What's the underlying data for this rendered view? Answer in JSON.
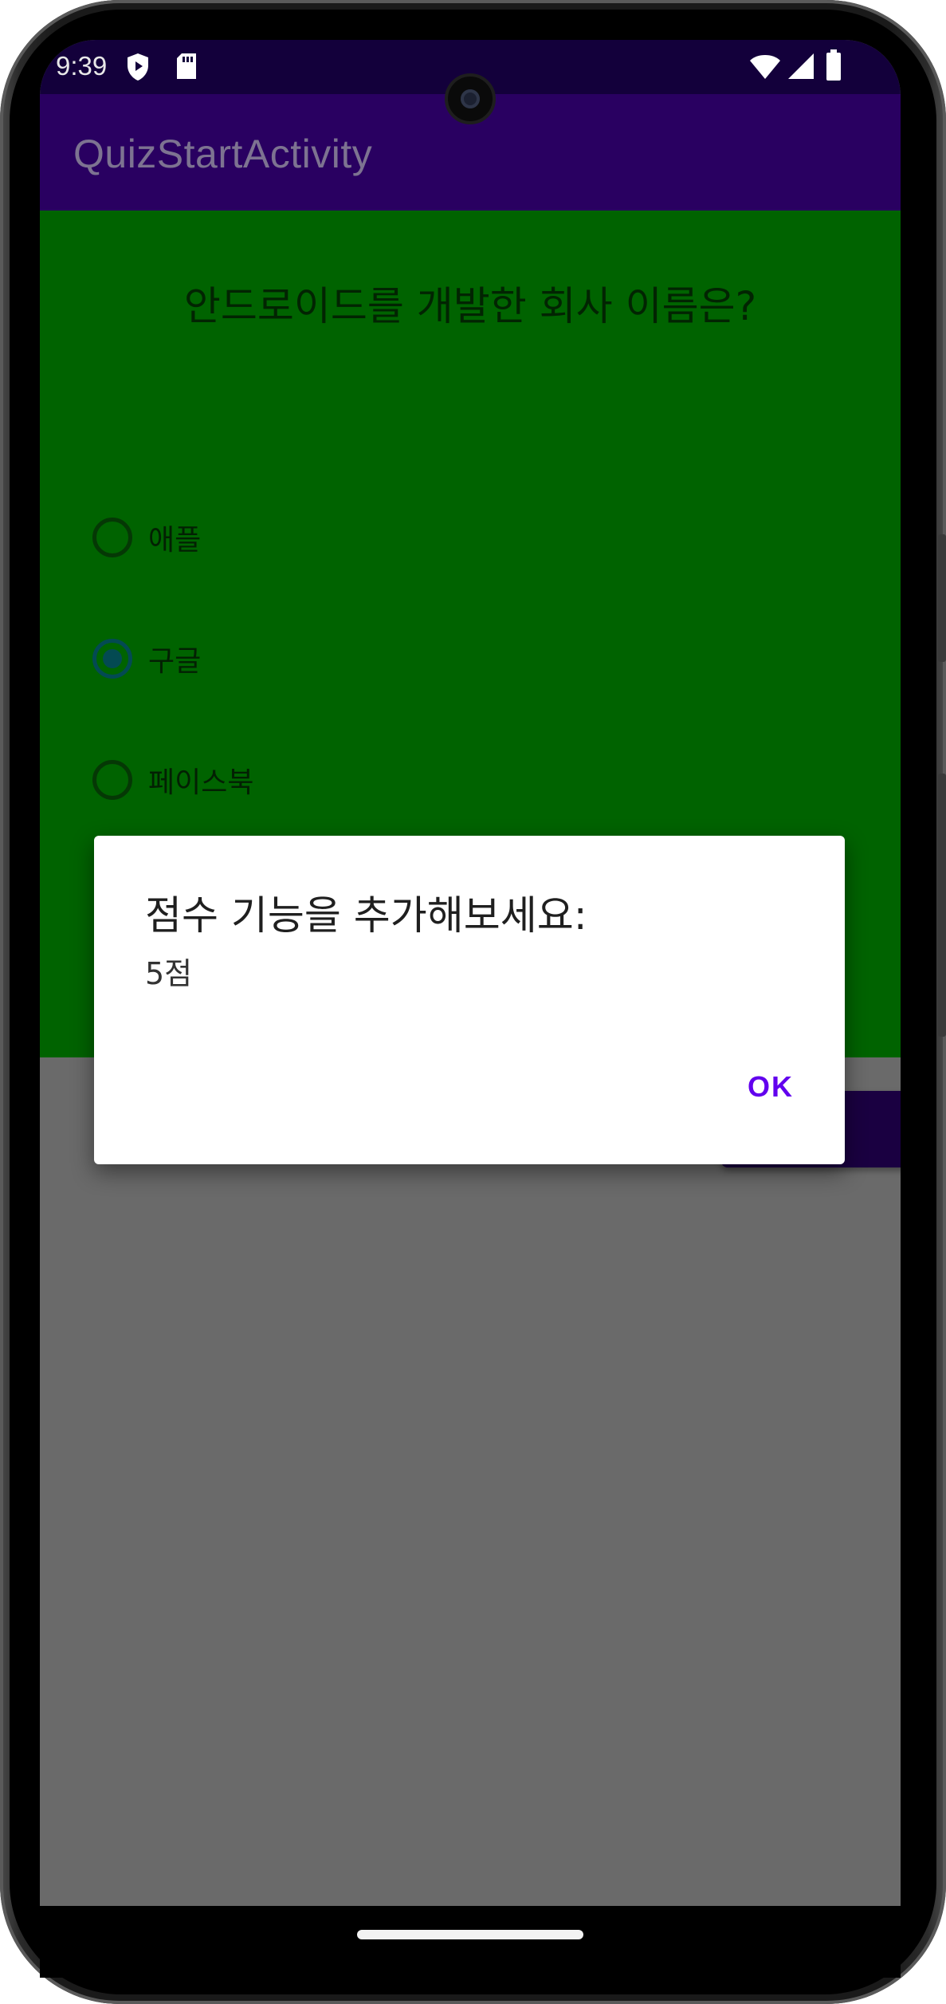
{
  "status_bar": {
    "time": "9:39",
    "left_icons": [
      "shield-icon",
      "sd-card-icon"
    ],
    "right_icons": [
      "wifi-icon",
      "signal-icon",
      "battery-icon"
    ]
  },
  "app_bar": {
    "title": "QuizStartActivity",
    "color": "#290061"
  },
  "quiz": {
    "question": "안드로이드를 개발한 회사 이름은?",
    "options": [
      {
        "label": "애플",
        "selected": false
      },
      {
        "label": "구글",
        "selected": true
      },
      {
        "label": "페이스북",
        "selected": false
      }
    ],
    "background": "#006300"
  },
  "dialog": {
    "title": "점수 기능을 추가해보세요:",
    "message": "5점",
    "ok_label": "OK",
    "accent": "#6200ee"
  }
}
